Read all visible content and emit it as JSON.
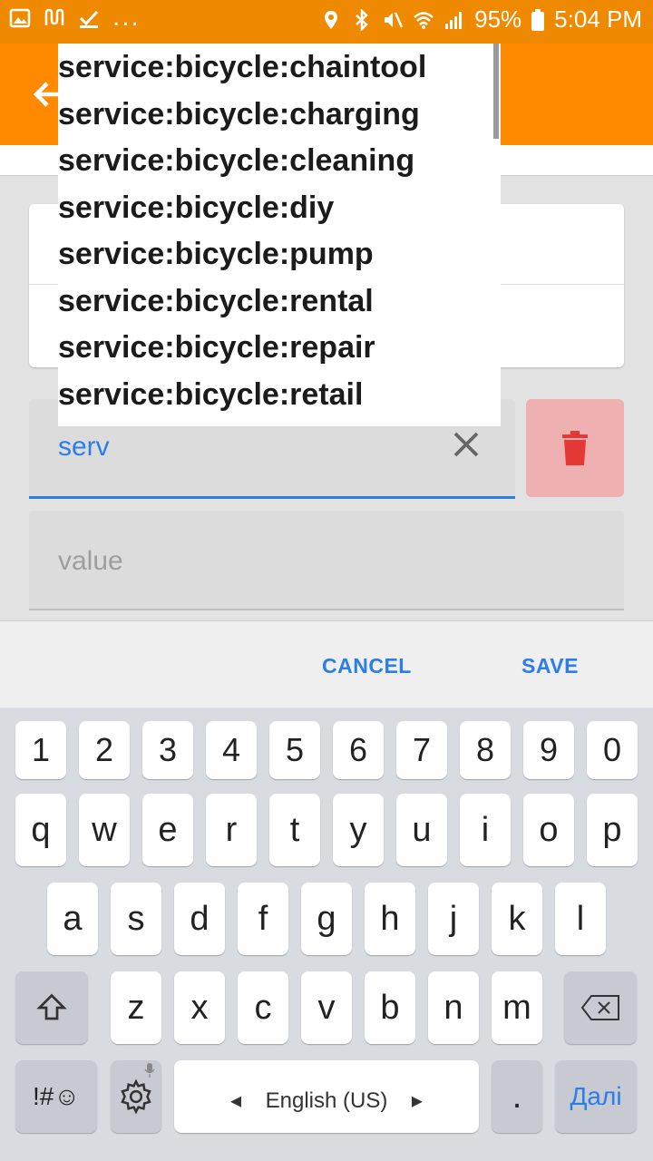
{
  "status": {
    "battery": "95%",
    "time": "5:04 PM",
    "more": "..."
  },
  "dropdown": {
    "items": [
      "service:bicycle:chaintool",
      "service:bicycle:charging",
      "service:bicycle:cleaning",
      "service:bicycle:diy",
      "service:bicycle:pump",
      "service:bicycle:rental",
      "service:bicycle:repair",
      "service:bicycle:retail"
    ]
  },
  "form": {
    "key_value": "serv",
    "value_placeholder": "value"
  },
  "actions": {
    "cancel": "CANCEL",
    "save": "SAVE"
  },
  "keyboard": {
    "numbers": [
      "1",
      "2",
      "3",
      "4",
      "5",
      "6",
      "7",
      "8",
      "9",
      "0"
    ],
    "row1": [
      "q",
      "w",
      "e",
      "r",
      "t",
      "y",
      "u",
      "i",
      "o",
      "p"
    ],
    "row2": [
      "a",
      "s",
      "d",
      "f",
      "g",
      "h",
      "j",
      "k",
      "l"
    ],
    "row3": [
      "z",
      "x",
      "c",
      "v",
      "b",
      "n",
      "m"
    ],
    "symbols": "!#☺",
    "language": "English (US)",
    "period": ".",
    "enter": "Далі"
  },
  "colors": {
    "accent": "#ff8a00",
    "link": "#2b7de9",
    "delete": "#e53935"
  }
}
